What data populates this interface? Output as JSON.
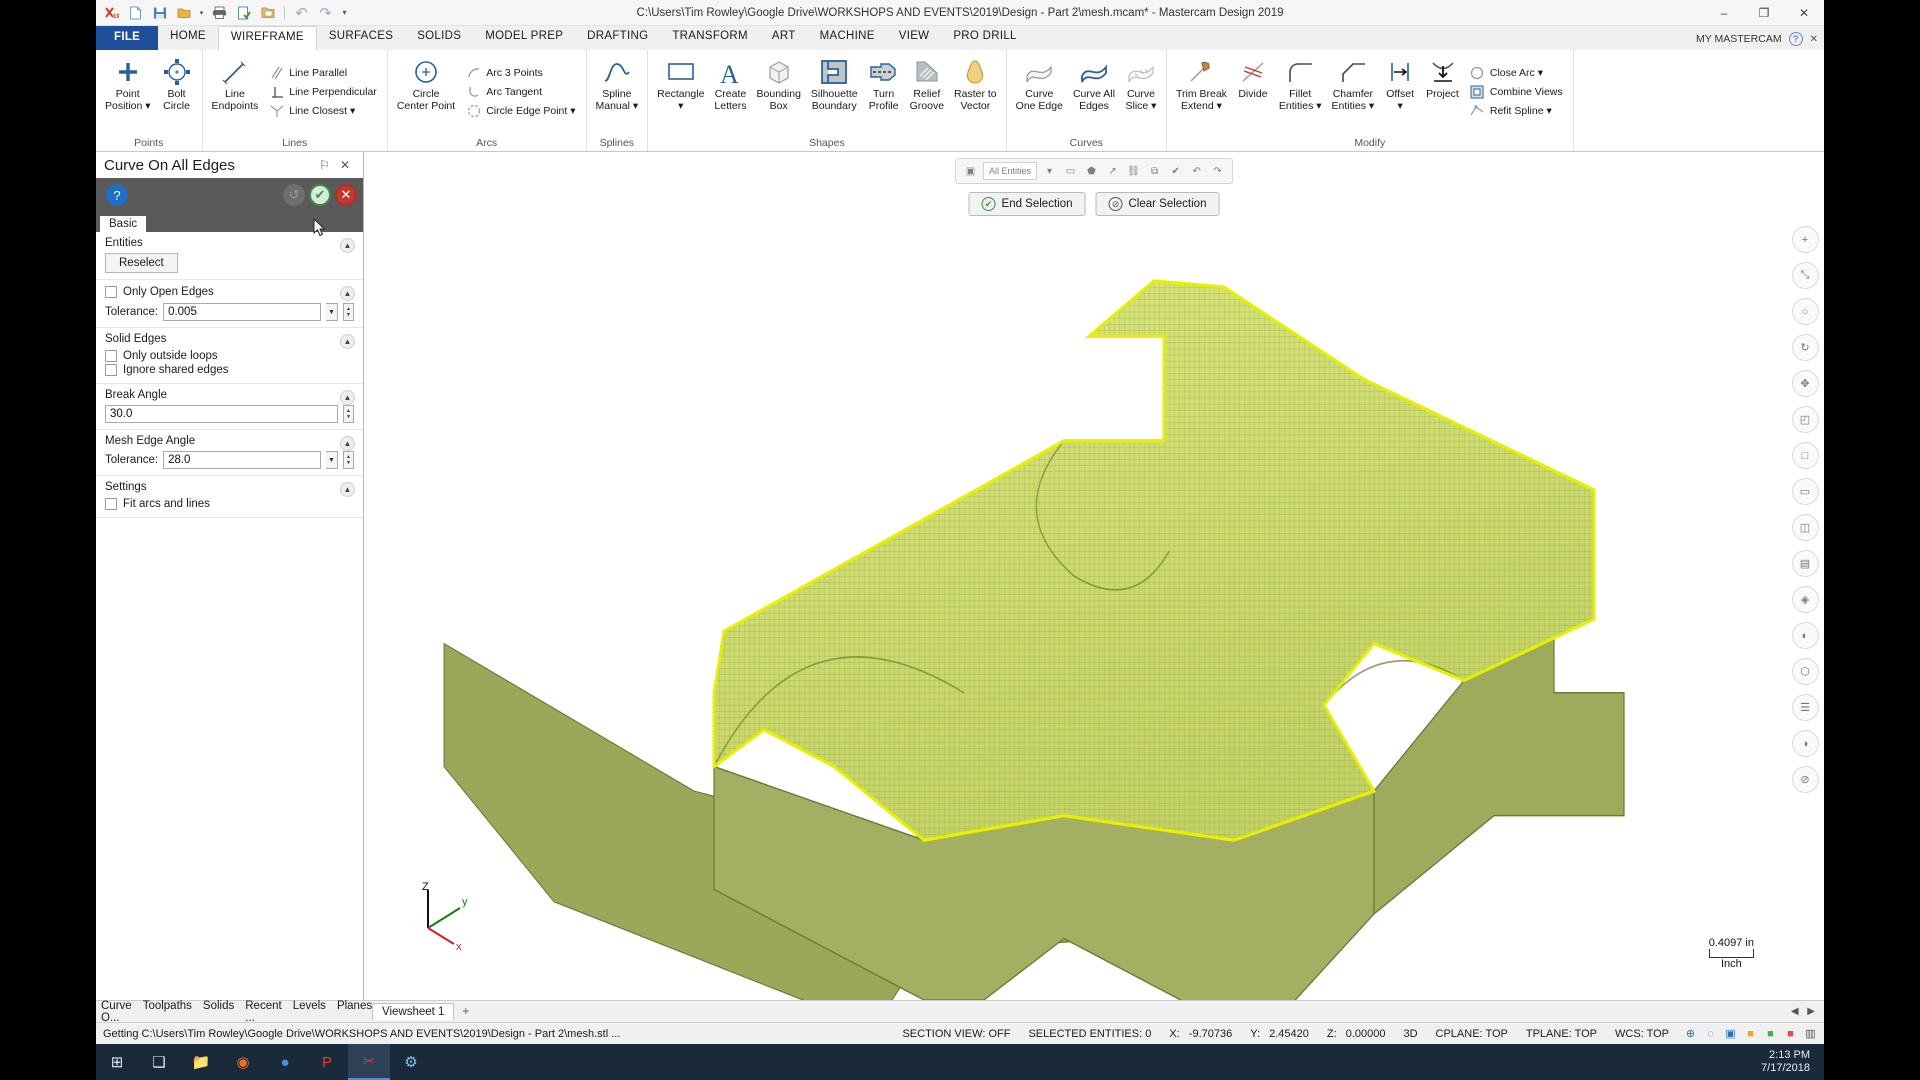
{
  "window": {
    "title": "C:\\Users\\Tim Rowley\\Google Drive\\WORKSHOPS AND EVENTS\\2019\\Design - Part 2\\mesh.mcam* - Mastercam Design 2019",
    "minimize": "–",
    "maximize": "❐",
    "close": "✕"
  },
  "quick_access": [
    {
      "name": "mastercam-logo-icon",
      "glyph": "✂"
    },
    {
      "name": "new-file-icon",
      "glyph": "⬜"
    },
    {
      "name": "save-icon",
      "glyph": "💾"
    },
    {
      "name": "open-folder-icon",
      "glyph": "📁"
    },
    {
      "name": "open-dropdown-icon",
      "glyph": "▾"
    },
    {
      "name": "print-icon",
      "glyph": "🖨"
    },
    {
      "name": "print-preview-icon",
      "glyph": "📝"
    },
    {
      "name": "file-manager-icon",
      "glyph": "🗂"
    },
    {
      "name": "undo-icon",
      "glyph": "↶"
    },
    {
      "name": "redo-icon",
      "glyph": "↷"
    },
    {
      "name": "customize-qat-icon",
      "glyph": "▾"
    }
  ],
  "tabs": [
    {
      "label": "FILE",
      "state": "file"
    },
    {
      "label": "HOME",
      "state": "normal"
    },
    {
      "label": "WIREFRAME",
      "state": "active"
    },
    {
      "label": "SURFACES",
      "state": "normal"
    },
    {
      "label": "SOLIDS",
      "state": "normal"
    },
    {
      "label": "MODEL PREP",
      "state": "normal"
    },
    {
      "label": "DRAFTING",
      "state": "normal"
    },
    {
      "label": "TRANSFORM",
      "state": "normal"
    },
    {
      "label": "ART",
      "state": "normal"
    },
    {
      "label": "MACHINE",
      "state": "normal"
    },
    {
      "label": "VIEW",
      "state": "normal"
    },
    {
      "label": "PRO DRILL",
      "state": "normal"
    }
  ],
  "account": {
    "label": "MY MASTERCAM",
    "help_glyph": "?",
    "close_glyph": "✕"
  },
  "ribbon": {
    "groups": [
      {
        "name": "Points",
        "big": [
          {
            "label": "Point\nPosition ▾",
            "icon": "point-position-icon"
          },
          {
            "label": "Bolt\nCircle",
            "icon": "bolt-circle-icon"
          }
        ],
        "small": []
      },
      {
        "name": "Lines",
        "big": [
          {
            "label": "Line\nEndpoints",
            "icon": "line-endpoints-icon"
          }
        ],
        "small": [
          {
            "label": "Line Parallel",
            "icon": "line-parallel-icon"
          },
          {
            "label": "Line Perpendicular",
            "icon": "line-perpendicular-icon"
          },
          {
            "label": "Line Closest ▾",
            "icon": "line-closest-icon"
          }
        ]
      },
      {
        "name": "Arcs",
        "big": [
          {
            "label": "Circle\nCenter Point",
            "icon": "circle-center-point-icon"
          }
        ],
        "small": [
          {
            "label": "Arc 3 Points",
            "icon": "arc-3-points-icon"
          },
          {
            "label": "Arc Tangent",
            "icon": "arc-tangent-icon"
          },
          {
            "label": "Circle Edge Point ▾",
            "icon": "circle-edge-point-icon"
          }
        ]
      },
      {
        "name": "Splines",
        "big": [
          {
            "label": "Spline\nManual ▾",
            "icon": "spline-manual-icon"
          }
        ],
        "small": []
      },
      {
        "name": "Shapes",
        "big": [
          {
            "label": "Rectangle\n▾",
            "icon": "rectangle-icon"
          },
          {
            "label": "Create\nLetters",
            "icon": "create-letters-icon"
          },
          {
            "label": "Bounding\nBox",
            "icon": "bounding-box-icon"
          },
          {
            "label": "Silhouette\nBoundary",
            "icon": "silhouette-boundary-icon"
          },
          {
            "label": "Turn\nProfile",
            "icon": "turn-profile-icon"
          },
          {
            "label": "Relief\nGroove",
            "icon": "relief-groove-icon"
          },
          {
            "label": "Raster to\nVector",
            "icon": "raster-to-vector-icon"
          }
        ],
        "small": []
      },
      {
        "name": "Curves",
        "big": [
          {
            "label": "Curve\nOne Edge",
            "icon": "curve-one-edge-icon"
          },
          {
            "label": "Curve All\nEdges",
            "icon": "curve-all-edges-icon"
          },
          {
            "label": "Curve\nSlice ▾",
            "icon": "curve-slice-icon"
          }
        ],
        "small": []
      },
      {
        "name": "Modify",
        "big": [
          {
            "label": "Trim Break\nExtend ▾",
            "icon": "trim-break-extend-icon"
          },
          {
            "label": "Divide",
            "icon": "divide-icon"
          },
          {
            "label": "Fillet\nEntities ▾",
            "icon": "fillet-entities-icon"
          },
          {
            "label": "Chamfer\nEntities ▾",
            "icon": "chamfer-entities-icon"
          },
          {
            "label": "Offset\n▾",
            "icon": "offset-icon"
          },
          {
            "label": "Project",
            "icon": "project-icon"
          }
        ],
        "small": [
          {
            "label": "Close Arc ▾",
            "icon": "close-arc-icon"
          },
          {
            "label": "Combine Views",
            "icon": "combine-views-icon"
          },
          {
            "label": "Refit Spline ▾",
            "icon": "refit-spline-icon"
          }
        ]
      }
    ]
  },
  "panel": {
    "title": "Curve On All Edges",
    "pin_glyph": "⚐",
    "close_glyph": "✕",
    "help_glyph": "?",
    "apply_glyph": "↺",
    "ok_glyph": "✔",
    "cancel_glyph": "✕",
    "tab": "Basic",
    "sections": [
      {
        "header": "Entities",
        "button": "Reselect"
      },
      {
        "checkbox": "Only Open Edges",
        "field_label": "Tolerance:",
        "field_value": "0.005"
      },
      {
        "header": "Solid Edges",
        "checkbox1": "Only outside loops",
        "checkbox2": "Ignore shared edges"
      },
      {
        "header": "Break Angle",
        "field_value": "30.0"
      },
      {
        "header": "Mesh Edge Angle",
        "field_label": "Tolerance:",
        "field_value": "28.0"
      },
      {
        "header": "Settings",
        "checkbox": "Fit arcs and lines"
      }
    ]
  },
  "viewport": {
    "selection": {
      "end": "End Selection",
      "end_icon_glyph": "✔",
      "clear": "Clear Selection",
      "clear_icon_glyph": "⊘"
    },
    "mini_toolbar": [
      {
        "name": "selection-mode-icon",
        "glyph": "▣"
      },
      {
        "name": "all-entities-icon",
        "glyph": "All Entities"
      },
      {
        "name": "select-dropdown-icon",
        "glyph": "▾"
      },
      {
        "name": "window-select-icon",
        "glyph": "▭"
      },
      {
        "name": "polygon-select-icon",
        "glyph": "⬟"
      },
      {
        "name": "vector-select-icon",
        "glyph": "↗"
      },
      {
        "name": "chain-select-icon",
        "glyph": "⛓"
      },
      {
        "name": "partial-chain-icon",
        "glyph": "⧉"
      },
      {
        "name": "verify-select-icon",
        "glyph": "✔"
      },
      {
        "name": "undo-select-icon",
        "glyph": "↶"
      },
      {
        "name": "redo-select-icon",
        "glyph": "↷"
      }
    ],
    "right_tools": [
      {
        "name": "zoom-in-icon",
        "glyph": "+"
      },
      {
        "name": "fit-view-icon",
        "glyph": "⤡"
      },
      {
        "name": "unzoom-icon",
        "glyph": "○"
      },
      {
        "name": "dynamic-rotate-icon",
        "glyph": "↻"
      },
      {
        "name": "pan-icon",
        "glyph": "✥"
      },
      {
        "name": "isometric-view-icon",
        "glyph": "◰"
      },
      {
        "name": "top-view-icon",
        "glyph": "□"
      },
      {
        "name": "front-view-icon",
        "glyph": "▭"
      },
      {
        "name": "right-view-icon",
        "glyph": "◫"
      },
      {
        "name": "wireframe-shading-icon",
        "glyph": "▤"
      },
      {
        "name": "shaded-icon",
        "glyph": "◈"
      },
      {
        "name": "translucency-icon",
        "glyph": "◐"
      },
      {
        "name": "mesh-display-icon",
        "glyph": "⬡"
      },
      {
        "name": "layers-icon",
        "glyph": "☰"
      },
      {
        "name": "section-view-icon",
        "glyph": "◑"
      },
      {
        "name": "blank-entities-icon",
        "glyph": "⊘"
      }
    ],
    "axis": {
      "z": "Z",
      "y": "y",
      "x": "x"
    },
    "scale": {
      "value": "0.4097 in",
      "unit": "Inch"
    }
  },
  "bottom_tabs": {
    "left": [
      "Curve O...",
      "Toolpaths",
      "Solids",
      "Recent ...",
      "Levels",
      "Planes"
    ],
    "viewsheet": "Viewsheet 1",
    "add": "+",
    "nav": "◀ ▶"
  },
  "status": {
    "message": "Getting C:\\Users\\Tim Rowley\\Google Drive\\WORKSHOPS AND EVENTS\\2019\\Design - Part 2\\mesh.stl ...",
    "section_view": "SECTION VIEW: OFF",
    "selected_entities": "SELECTED ENTITIES: 0",
    "x_label": "X:",
    "x_value": "-9.70736",
    "y_label": "Y:",
    "y_value": "2.45420",
    "z_label": "Z:",
    "z_value": "0.00000",
    "mode": "3D",
    "cplane": "CPLANE: TOP",
    "tplane": "TPLANE: TOP",
    "wcs": "WCS: TOP",
    "icons": [
      {
        "name": "grid-snap-icon",
        "glyph": "⊕",
        "color": "#2a6fb8"
      },
      {
        "name": "world-axes-icon",
        "glyph": "◌",
        "color": "#2a6fb8"
      },
      {
        "name": "visible-levels-icon",
        "glyph": "▣",
        "color": "#2a6fb8"
      },
      {
        "name": "color-swatch-icon",
        "glyph": "■",
        "color": "#e8a33d"
      },
      {
        "name": "level-swatch-icon",
        "glyph": "■",
        "color": "#49b04a"
      },
      {
        "name": "attribute-icon",
        "glyph": "■",
        "color": "#d94f4f"
      },
      {
        "name": "style-icon",
        "glyph": "▥",
        "color": "#555"
      }
    ]
  },
  "taskbar": {
    "items": [
      {
        "name": "start-button-icon",
        "glyph": "⊞",
        "color": "#dfe6ee"
      },
      {
        "name": "task-view-icon",
        "glyph": "❑",
        "color": "#dfe6ee"
      },
      {
        "name": "file-explorer-icon",
        "glyph": "📁",
        "color": "#e3b23c"
      },
      {
        "name": "firefox-icon",
        "glyph": "◉",
        "color": "#e8722a"
      },
      {
        "name": "chrome-icon",
        "glyph": "●",
        "color": "#4a90d9"
      },
      {
        "name": "powerpoint-icon",
        "glyph": "P",
        "color": "#d24726"
      },
      {
        "name": "mastercam-taskbar-icon",
        "glyph": "✂",
        "color": "#d63a2f"
      },
      {
        "name": "settings-icon",
        "glyph": "⚙",
        "color": "#7fc4ea"
      }
    ],
    "time": "2:13 PM",
    "date": "7/17/2018"
  }
}
